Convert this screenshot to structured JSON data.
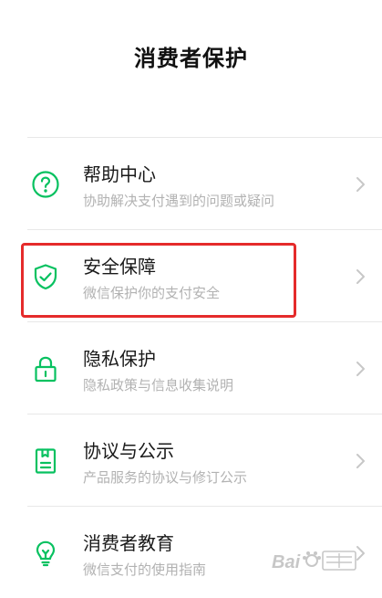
{
  "header": {
    "title": "消费者保护"
  },
  "colors": {
    "accent": "#07c160",
    "highlight": "#e52b2b",
    "subtitle": "#b2b2b2",
    "chevron": "#c7c7c7"
  },
  "menu": {
    "items": [
      {
        "title": "帮助中心",
        "subtitle": "协助解决支付遇到的问题或疑问",
        "icon": "question-circle-icon"
      },
      {
        "title": "安全保障",
        "subtitle": "微信保护你的支付安全",
        "icon": "shield-check-icon"
      },
      {
        "title": "隐私保护",
        "subtitle": "隐私政策与信息收集说明",
        "icon": "lock-icon"
      },
      {
        "title": "协议与公示",
        "subtitle": "产品服务的协议与修订公示",
        "icon": "document-icon"
      },
      {
        "title": "消费者教育",
        "subtitle": "微信支付的使用指南",
        "icon": "lightbulb-icon"
      }
    ]
  },
  "watermark": {
    "text": "Baidu 经验"
  }
}
